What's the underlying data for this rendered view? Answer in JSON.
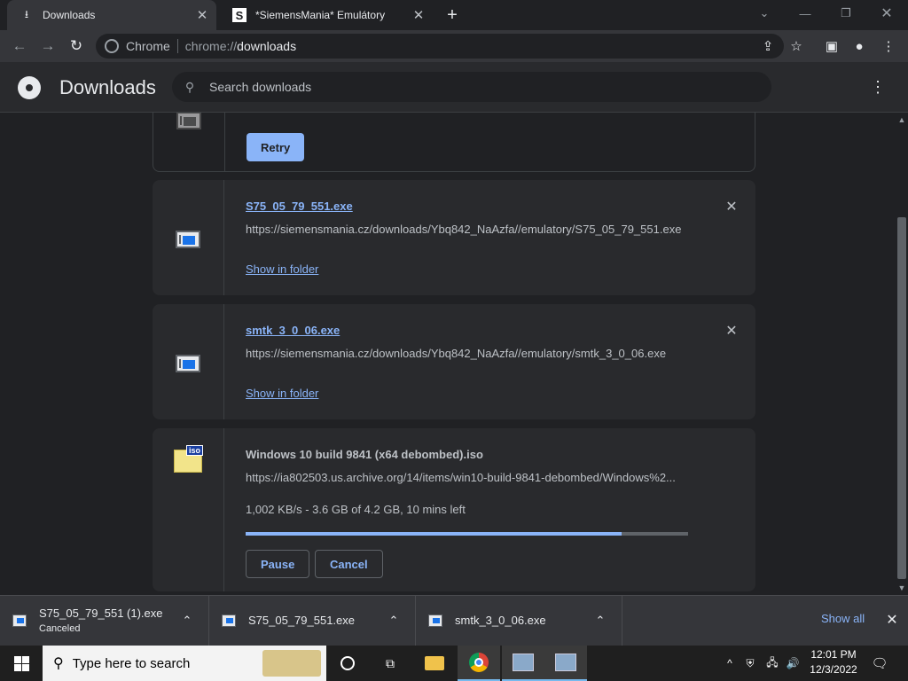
{
  "browser": {
    "tabs": [
      {
        "title": "Downloads",
        "icon": "download-icon",
        "active": true
      },
      {
        "title": "*SiemensMania* Emulátory",
        "icon": "siemensmania-favicon",
        "favicon_text": "S",
        "active": false
      }
    ],
    "omnibox": {
      "site_name": "Chrome",
      "url_scheme": "chrome://",
      "url_host": "downloads"
    }
  },
  "downloads_page": {
    "title": "Downloads",
    "search_placeholder": "Search downloads",
    "items": [
      {
        "retry_label": "Retry"
      },
      {
        "filename": "S75_05_79_551.exe",
        "url": "https://siemensmania.cz/downloads/Ybq842_NaAzfa//emulatory/S75_05_79_551.exe",
        "action": "Show in folder"
      },
      {
        "filename": "smtk_3_0_06.exe",
        "url": "https://siemensmania.cz/downloads/Ybq842_NaAzfa//emulatory/smtk_3_0_06.exe",
        "action": "Show in folder"
      },
      {
        "filename": "Windows 10 build 9841 (x64 debombed).iso",
        "url": "https://ia802503.us.archive.org/14/items/win10-build-9841-debombed/Windows%2...",
        "status": "1,002 KB/s - 3.6 GB of 4.2 GB, 10 mins left",
        "progress_fraction": 0.85,
        "pause_label": "Pause",
        "cancel_label": "Cancel",
        "icon_badge": "iso"
      }
    ]
  },
  "shelf": {
    "items": [
      {
        "name": "S75_05_79_551 (1).exe",
        "status": "Canceled"
      },
      {
        "name": "S75_05_79_551.exe"
      },
      {
        "name": "smtk_3_0_06.exe"
      }
    ],
    "show_all": "Show all"
  },
  "taskbar": {
    "search_placeholder": "Type here to search",
    "time": "12:01 PM",
    "date": "12/3/2022"
  },
  "colors": {
    "accent": "#8ab4f8",
    "background": "#202124",
    "card": "#292a2d",
    "taskbar": "#1f1f1f"
  }
}
